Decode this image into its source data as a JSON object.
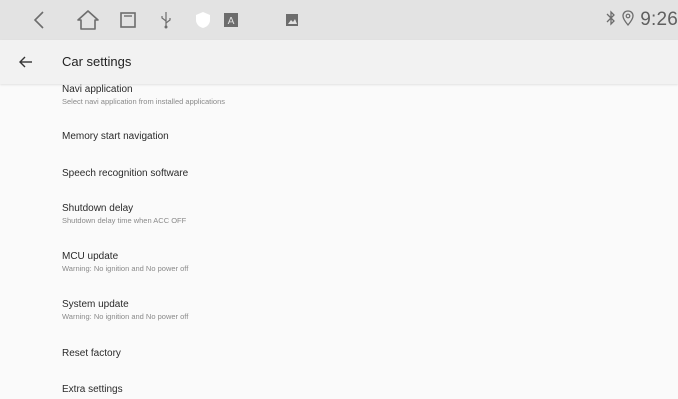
{
  "status_bar": {
    "icons": [
      "back-nav-icon",
      "home-icon",
      "recents-icon",
      "usb-icon",
      "shield-icon",
      "keyboard-icon",
      "image-icon",
      "bluetooth-icon",
      "location-icon"
    ],
    "time": "9:26"
  },
  "app_bar": {
    "title": "Car settings",
    "back_icon": "arrow-left-icon"
  },
  "settings": [
    {
      "title": "Navi application",
      "subtitle": "Select navi application from installed applications"
    },
    {
      "title": "Memory start navigation",
      "subtitle": ""
    },
    {
      "title": "Speech recognition software",
      "subtitle": ""
    },
    {
      "title": "Shutdown delay",
      "subtitle": "Shutdown delay time when ACC OFF"
    },
    {
      "title": "MCU update",
      "subtitle": "Warning: No ignition and No power off"
    },
    {
      "title": "System update",
      "subtitle": "Warning: No ignition and No power off"
    },
    {
      "title": "Reset factory",
      "subtitle": ""
    },
    {
      "title": "Extra settings",
      "subtitle": ""
    }
  ]
}
